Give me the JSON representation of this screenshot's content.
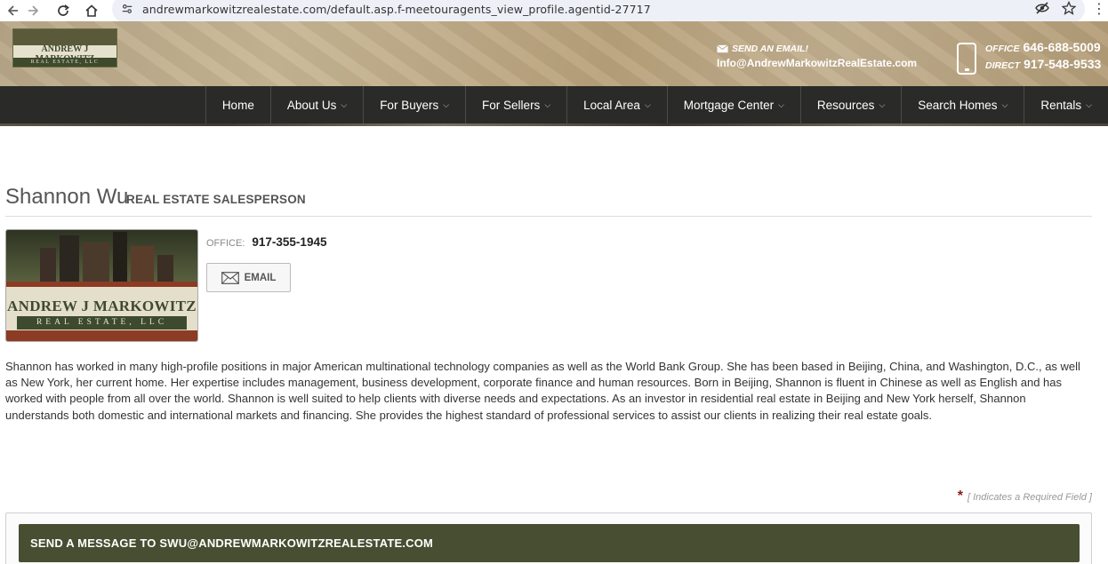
{
  "browser": {
    "url": "andrewmarkowitzrealestate.com/default.asp.f-meetouragents_view_profile.agentid-27717"
  },
  "header": {
    "logo_name": "ANDREW J MARKOWITZ",
    "logo_sub": "REAL ESTATE, LLC",
    "email_label": "SEND AN EMAIL!",
    "email_address": "Info@AndrewMarkowitzRealEstate.com",
    "office_label": "OFFICE",
    "office_phone": "646-688-5009",
    "direct_label": "DIRECT",
    "direct_phone": "917-548-9533"
  },
  "nav": {
    "items": [
      {
        "label": "Home"
      },
      {
        "label": "About Us"
      },
      {
        "label": "For Buyers"
      },
      {
        "label": "For Sellers"
      },
      {
        "label": "Local Area"
      },
      {
        "label": "Mortgage Center"
      },
      {
        "label": "Resources"
      },
      {
        "label": "Search Homes"
      },
      {
        "label": "Rentals"
      }
    ]
  },
  "profile": {
    "name": "Shannon Wu",
    "title": "REAL ESTATE SALESPERSON",
    "photo_brand": "ANDREW J MARKOWITZ",
    "photo_sub": "REAL ESTATE, LLC",
    "office_label": "OFFICE:",
    "office_phone": "917-355-1945",
    "email_button": "EMAIL",
    "bio": "Shannon has worked in many high-profile positions in major American multinational technology companies as well as the World Bank Group. She has been based in Beijing, China, and Washington, D.C., as well as New York, her current home. Her expertise includes management, business development, corporate finance and human resources. Born in Beijing, Shannon is fluent in Chinese as well as English and has worked with people from all over the world. Shannon is well suited to help clients with diverse needs and expectations. As an investor in residential real estate in Beijing and New York herself, Shannon understands both domestic and international markets and financing. She provides the highest standard of professional services to assist our clients in realizing their real estate goals."
  },
  "form": {
    "required_star": "*",
    "required_note": "[ Indicates a Required Field ]",
    "header": "SEND A MESSAGE TO SWU@ANDREWMARKOWITZREALESTATE.COM"
  },
  "colors": {
    "nav_bg": "#2a2a28",
    "form_header_bg": "#474e31",
    "required_star": "#8b1a1a"
  }
}
